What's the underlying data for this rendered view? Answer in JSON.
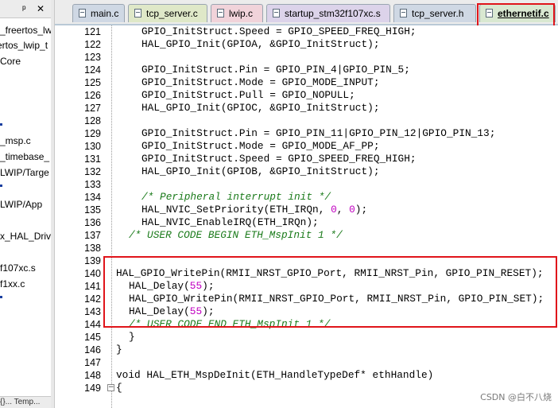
{
  "left_panel": {
    "pin_glyph": "ᵖ",
    "close_glyph": "✕",
    "rows": [
      "_freertos_lw",
      "ertos_lwip_t",
      "Core",
      "_msp.c",
      "_timebase_",
      "LWIP/Targe",
      "LWIP/App",
      "x_HAL_Driv",
      "f107xc.s",
      "f1xx.c"
    ],
    "bottom_label": "{}... Temp..."
  },
  "tabs": [
    {
      "label": "main.c",
      "color": "#cfd8e4"
    },
    {
      "label": "tcp_server.c",
      "color": "#dfe8c8"
    },
    {
      "label": "lwip.c",
      "color": "#f1d3da"
    },
    {
      "label": "startup_stm32f107xc.s",
      "color": "#dcd3ea"
    },
    {
      "label": "tcp_server.h",
      "color": "#cfd8e4"
    },
    {
      "label": "ethernetif.c",
      "color": "#d9e8d1",
      "active": true
    }
  ],
  "colors": {
    "highlight_box": "#e0141a",
    "comment": "#1a7a1a",
    "keyword": "#1f1fcf",
    "number": "#c000c0"
  },
  "code_lines": [
    {
      "num": "121",
      "text": "GPIO_InitStruct.Speed = GPIO_SPEED_FREQ_HIGH;"
    },
    {
      "num": "122",
      "text": "HAL_GPIO_Init(GPIOA, &GPIO_InitStruct);"
    },
    {
      "num": "123",
      "text": ""
    },
    {
      "num": "124",
      "text": "GPIO_InitStruct.Pin = GPIO_PIN_4|GPIO_PIN_5;"
    },
    {
      "num": "125",
      "text": "GPIO_InitStruct.Mode = GPIO_MODE_INPUT;"
    },
    {
      "num": "126",
      "text": "GPIO_InitStruct.Pull = GPIO_NOPULL;"
    },
    {
      "num": "127",
      "text": "HAL_GPIO_Init(GPIOC, &GPIO_InitStruct);"
    },
    {
      "num": "128",
      "text": ""
    },
    {
      "num": "129",
      "text": "GPIO_InitStruct.Pin = GPIO_PIN_11|GPIO_PIN_12|GPIO_PIN_13;"
    },
    {
      "num": "130",
      "text": "GPIO_InitStruct.Mode = GPIO_MODE_AF_PP;"
    },
    {
      "num": "131",
      "text": "GPIO_InitStruct.Speed = GPIO_SPEED_FREQ_HIGH;"
    },
    {
      "num": "132",
      "text": "HAL_GPIO_Init(GPIOB, &GPIO_InitStruct);"
    },
    {
      "num": "133",
      "text": ""
    },
    {
      "num": "134",
      "text": "/* Peripheral interrupt init */"
    },
    {
      "num": "135",
      "text_pre": "HAL_NVIC_SetPriority(ETH_IRQn, ",
      "n1": "0",
      "mid": ", ",
      "n2": "0",
      "text_post": ");"
    },
    {
      "num": "136",
      "text": "HAL_NVIC_EnableIRQ(ETH_IRQn);"
    },
    {
      "num": "137",
      "text": "/* USER CODE BEGIN ETH_MspInit 1 */"
    },
    {
      "num": "138",
      "text": ""
    },
    {
      "num": "139",
      "text": ""
    },
    {
      "num": "140",
      "text": "HAL_GPIO_WritePin(RMII_NRST_GPIO_Port, RMII_NRST_Pin, GPIO_PIN_RESET);"
    },
    {
      "num": "141",
      "text_pre": "HAL_Delay(",
      "n1": "55",
      "text_post": ");"
    },
    {
      "num": "142",
      "text": "HAL_GPIO_WritePin(RMII_NRST_GPIO_Port, RMII_NRST_Pin, GPIO_PIN_SET);"
    },
    {
      "num": "143",
      "text_pre": "HAL_Delay(",
      "n1": "55",
      "text_post": ");"
    },
    {
      "num": "144",
      "text": "/* USER CODE END ETH_MspInit 1 */"
    },
    {
      "num": "145",
      "text": "}"
    },
    {
      "num": "146",
      "text": "}"
    },
    {
      "num": "147",
      "text": ""
    },
    {
      "num": "148",
      "text_kw": "void",
      "text_post": " HAL_ETH_MspDeInit(ETH_HandleTypeDef* ethHandle)"
    },
    {
      "num": "149",
      "text": "{",
      "fold": "−"
    }
  ],
  "watermark": "CSDN @白不八烧"
}
